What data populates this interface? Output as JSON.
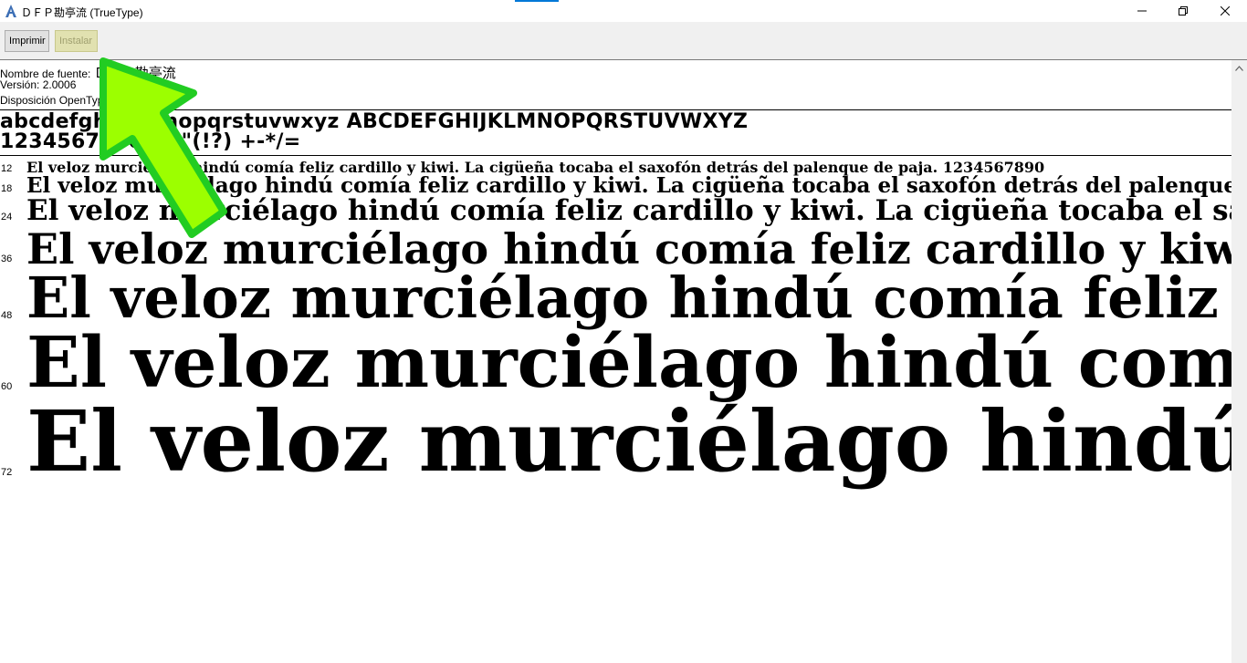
{
  "window": {
    "title": "ＤＦＰ勘亭流 (TrueType)",
    "controls": {
      "minimize": "minimize",
      "maximize": "maximize",
      "close": "close"
    }
  },
  "toolbar": {
    "print_label": "Imprimir",
    "install_label": "Instalar"
  },
  "info": {
    "font_name_label": "Nombre de fuente: ",
    "font_name_value": "ＤＦＰ勘亭流",
    "version": "Versión: 2.0006",
    "layout": "Disposición OpenType, contornos"
  },
  "samples": {
    "alphabet": "abcdefghijklmnopqrstuvwxyz ABCDEFGHIJKLMNOPQRSTUVWXYZ",
    "digits": "1234567890.:,;'\"(!?) +-*/="
  },
  "sizes": [
    {
      "label": "12",
      "text": "El veloz murciélago hindú comía feliz cardillo y kiwi. La cigüeña tocaba el saxofón detrás del palenque de paja. 1234567890"
    },
    {
      "label": "18",
      "text": "El veloz murciélago hindú comía feliz cardillo y kiwi. La cigüeña tocaba el saxofón detrás del palenque de paja."
    },
    {
      "label": "24",
      "text": "El veloz murciélago hindú comía feliz cardillo y kiwi. La cigüeña tocaba el saxofón"
    },
    {
      "label": "36",
      "text": "El veloz murciélago hindú comía feliz cardillo y kiwi."
    },
    {
      "label": "48",
      "text": "El veloz murciélago hindú comía feliz cardillo"
    },
    {
      "label": "60",
      "text": "El veloz murciélago hindú comía feliz"
    },
    {
      "label": "72",
      "text": "El veloz murciélago hindú comía"
    }
  ],
  "colors": {
    "arrow_fill": "#9cff00",
    "arrow_outline": "#22cc22",
    "accent": "#0078d7"
  }
}
